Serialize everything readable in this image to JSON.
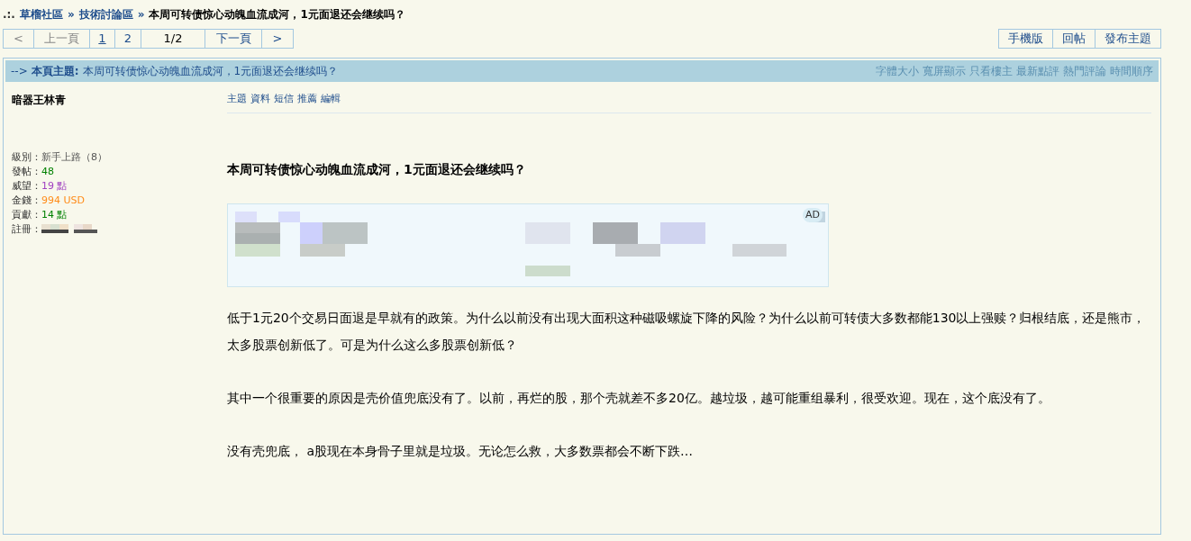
{
  "breadcrumb": {
    "prefix": ".:.",
    "items": [
      "草榴社區",
      "技術討論區"
    ],
    "separator": "»",
    "current": "本周可转债惊心动魄血流成河，1元面退还会继续吗？"
  },
  "pager": [
    {
      "label": "<",
      "kind": "nav"
    },
    {
      "label": "上一頁",
      "kind": "nav"
    },
    {
      "label": "1",
      "kind": "page",
      "selected": true
    },
    {
      "label": "2",
      "kind": "page",
      "selected": false
    },
    {
      "label": "1/2",
      "kind": "info"
    },
    {
      "label": "下一頁",
      "kind": "link"
    },
    {
      "label": ">",
      "kind": "link"
    }
  ],
  "actions": [
    "手機版",
    "回帖",
    "發布主題"
  ],
  "topic_bar": {
    "arrow": "-->",
    "label": "本頁主題:",
    "title": "本周可转债惊心动魄血流成河，1元面退还会继续吗？",
    "tools": [
      "字體大小",
      "寬屏顯示",
      "只看樓主",
      "最新點評",
      "熱門評論",
      "時間順序"
    ]
  },
  "author": {
    "name": "暗器王林青",
    "stats": [
      {
        "label": "級別：",
        "value": "新手上路（8）",
        "color": "#555555"
      },
      {
        "label": "發帖：",
        "value": "48",
        "color": "#008000"
      },
      {
        "label": "威望：",
        "value": "19 點",
        "color": "#a040c0"
      },
      {
        "label": "金錢：",
        "value": "994 USD",
        "color": "#ff8c1a"
      },
      {
        "label": "貢獻：",
        "value": "14 點",
        "color": "#008000"
      }
    ],
    "registered_label": "註冊："
  },
  "user_links": [
    "主題",
    "資料",
    "短信",
    "推薦",
    "編輯"
  ],
  "post": {
    "title": "本周可转债惊心动魄血流成河，1元面退还会继续吗？",
    "ad_badge": "AD",
    "paragraphs": [
      "低于1元20个交易日面退是早就有的政策。为什么以前没有出现大面积这种磁吸螺旋下降的风险？为什么以前可转债大多数都能130以上强赎？归根结底，还是熊市，太多股票创新低了。可是为什么这么多股票创新低？",
      "其中一个很重要的原因是壳价值兜底没有了。以前，再烂的股，那个壳就差不多20亿。越垃圾，越可能重组暴利，很受欢迎。现在，这个底没有了。",
      "没有壳兜底， a股现在本身骨子里就是垃圾。无论怎么救，大多数票都会不断下跌…"
    ]
  }
}
